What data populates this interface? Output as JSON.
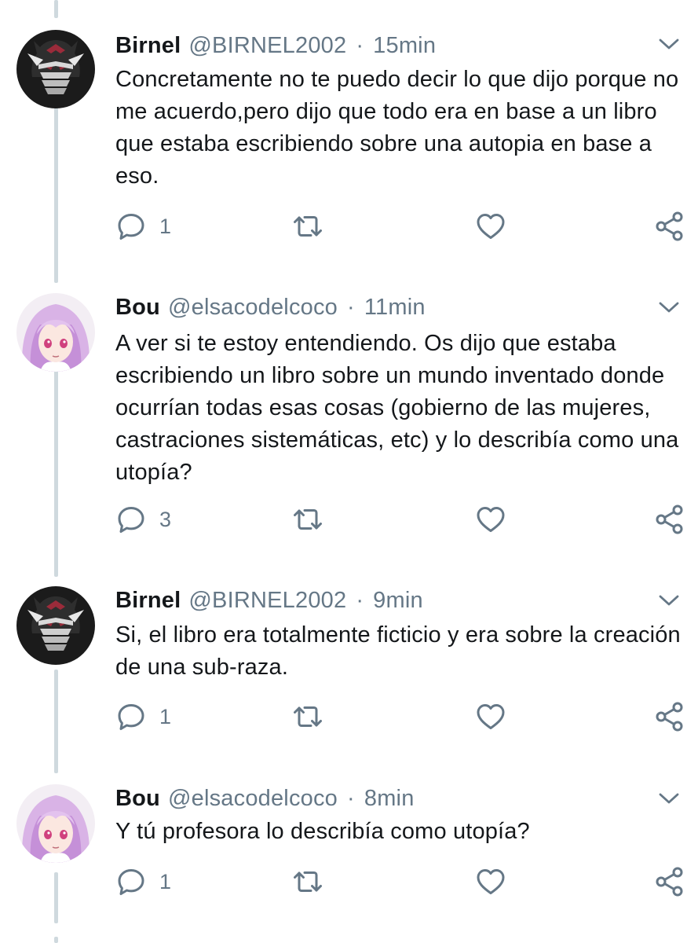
{
  "tweets": [
    {
      "name": "Birnel",
      "handle": "@BIRNEL2002",
      "dot": "·",
      "time": "15min",
      "text": "Concretamente no te puedo decir lo que dijo porque no me acuerdo,pero dijo que todo era en base a un libro que estaba escribiendo sobre una autopia en base a eso.",
      "reply_count": "1",
      "avatar": "samurai-helmet-avatar"
    },
    {
      "name": "Bou",
      "handle": "@elsacodelcoco",
      "dot": "·",
      "time": "11min",
      "text": "A ver si te estoy entendiendo. Os dijo que estaba escribiendo un libro sobre un mundo inventado donde ocurrían todas esas cosas (gobierno de las mujeres, castraciones sistemáticas, etc) y lo describía como una utopía?",
      "reply_count": "3",
      "avatar": "anime-girl-avatar"
    },
    {
      "name": "Birnel",
      "handle": "@BIRNEL2002",
      "dot": "·",
      "time": "9min",
      "text": "Si, el libro era totalmente ficticio y era sobre la creación de una sub-raza.",
      "reply_count": "1",
      "avatar": "samurai-helmet-avatar"
    },
    {
      "name": "Bou",
      "handle": "@elsacodelcoco",
      "dot": "·",
      "time": "8min",
      "text": "Y tú profesora lo describía como utopía?",
      "reply_count": "1",
      "avatar": "anime-girl-avatar"
    }
  ],
  "icons": {
    "reply": "reply-icon",
    "retweet": "retweet-icon",
    "like": "heart-icon",
    "share": "share-icon",
    "menu": "chevron-down-icon"
  },
  "colors": {
    "text": "#14171a",
    "secondary": "#657786",
    "thread_line": "#cfd9de"
  }
}
